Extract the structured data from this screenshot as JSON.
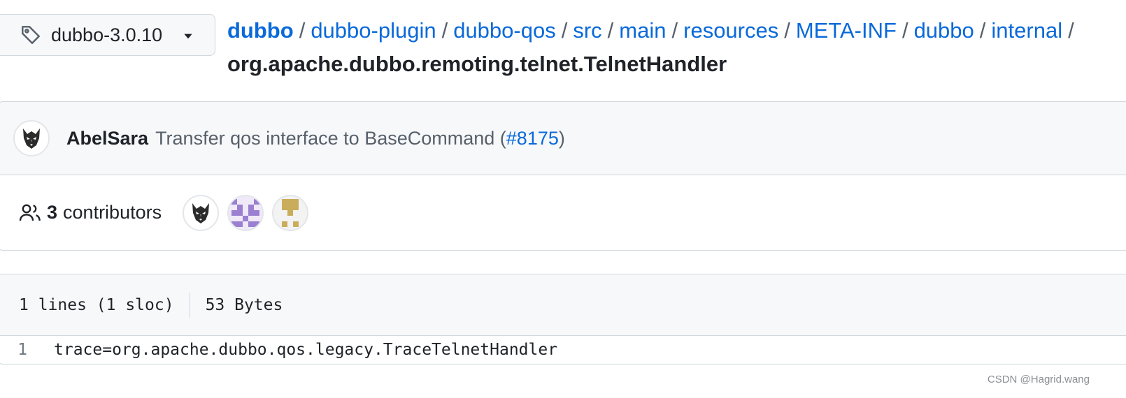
{
  "branch": {
    "name": "dubbo-3.0.10",
    "icon": "tag-icon"
  },
  "breadcrumb": {
    "root": "dubbo",
    "parts": [
      "dubbo-plugin",
      "dubbo-qos",
      "src",
      "main",
      "resources",
      "META-INF",
      "dubbo",
      "internal"
    ],
    "trailing_sep": "/",
    "file": "org.apache.dubbo.remoting.telnet.TelnetHandler"
  },
  "commit": {
    "author": "AbelSara",
    "message": "Transfer qos interface to BaseCommand (",
    "pr_link": "#8175",
    "message_end": ")"
  },
  "contributors": {
    "count": "3",
    "label": "contributors",
    "avatars": [
      "wolf-avatar",
      "purple-identicon-avatar",
      "gold-identicon-avatar"
    ]
  },
  "file_info": {
    "lines": "1 lines (1 sloc)",
    "size": "53 Bytes"
  },
  "code": [
    {
      "line": "1",
      "text": "trace=org.apache.dubbo.qos.legacy.TraceTelnetHandler"
    }
  ],
  "watermark": "CSDN @Hagrid.wang",
  "colors": {
    "link": "#0969da",
    "muted": "#57606a",
    "border": "#d0d7de",
    "header_bg": "#f6f8fa"
  }
}
